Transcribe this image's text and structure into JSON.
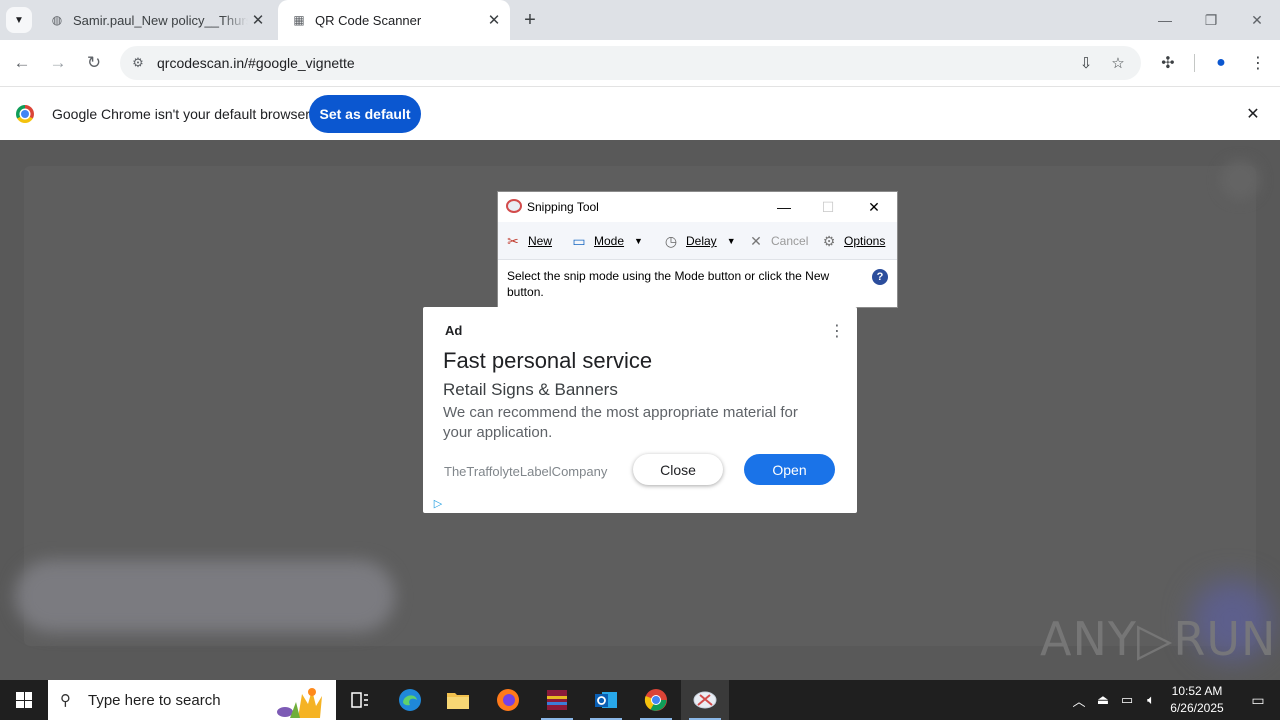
{
  "browser": {
    "tabs": [
      {
        "title": "Samir.paul_New policy__Thursd",
        "active": false
      },
      {
        "title": "QR Code Scanner",
        "active": true
      }
    ],
    "url": "qrcodescan.in/#google_vignette",
    "infobar": {
      "message": "Google Chrome isn't your default browser",
      "button": "Set as default"
    }
  },
  "snipping_tool": {
    "title": "Snipping Tool",
    "toolbar": {
      "new": "New",
      "mode": "Mode",
      "delay": "Delay",
      "cancel": "Cancel",
      "options": "Options"
    },
    "message": "Select the snip mode using the Mode button or click the New button.",
    "help": "?"
  },
  "ad": {
    "label": "Ad",
    "title": "Fast personal service",
    "subtitle": "Retail Signs & Banners",
    "description": "We can recommend the most appropriate material for your application.",
    "advertiser": "TheTraffolyteLabelCompany",
    "close_label": "Close",
    "open_label": "Open"
  },
  "watermark": "ANY▷RUN",
  "taskbar": {
    "search_placeholder": "Type here to search",
    "apps": [
      "task-view",
      "edge",
      "file-explorer",
      "firefox",
      "winrar",
      "outlook",
      "chrome",
      "snipping-tool"
    ],
    "time": "10:52 AM",
    "date": "6/26/2025"
  },
  "colors": {
    "chrome_blue": "#0b57d0",
    "ad_open_blue": "#1a73e8",
    "overlay": "#595959",
    "taskbar": "#1f1f1f"
  }
}
